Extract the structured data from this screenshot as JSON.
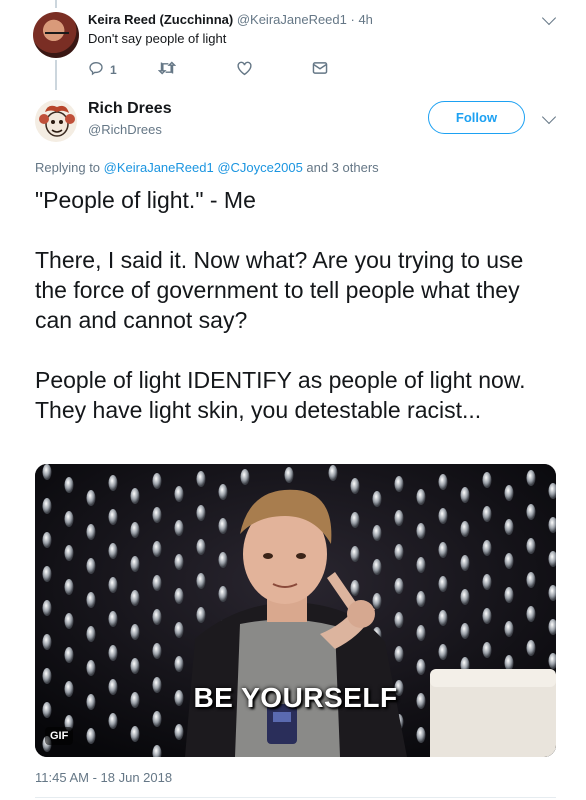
{
  "reply_tweet": {
    "display_name": "Keira Reed (Zucchinna)",
    "handle": "@KeiraJaneReed1",
    "separator": " · ",
    "age": "4h",
    "text": "Don't say people of light",
    "reply_count": "1",
    "icons": [
      "reply-icon",
      "retweet-icon",
      "like-icon",
      "direct-message-icon",
      "chevron-down-icon"
    ]
  },
  "main_tweet": {
    "display_name": "Rich Drees",
    "handle": "@RichDrees",
    "follow_label": "Follow",
    "replying_prefix": "Replying to ",
    "replying_mentions": [
      "@KeiraJaneReed1",
      "@CJoyce2005"
    ],
    "replying_suffix": " and 3 others",
    "paragraphs": [
      "\"People of light.\" - Me",
      "There, I said it. Now what? Are you trying to use the force of government to tell people what they can and cannot say?",
      "People of light IDENTIFY as people of light now. They have light skin, you detestable racist..."
    ],
    "media": {
      "caption": "BE YOURSELF",
      "badge": "GIF"
    },
    "timestamp": "11:45 AM - 18 Jun 2018"
  },
  "colors": {
    "accent": "#1da1f2",
    "link": "#1b95e0",
    "secondary_text": "#657786",
    "divider": "#e6ecf0"
  }
}
